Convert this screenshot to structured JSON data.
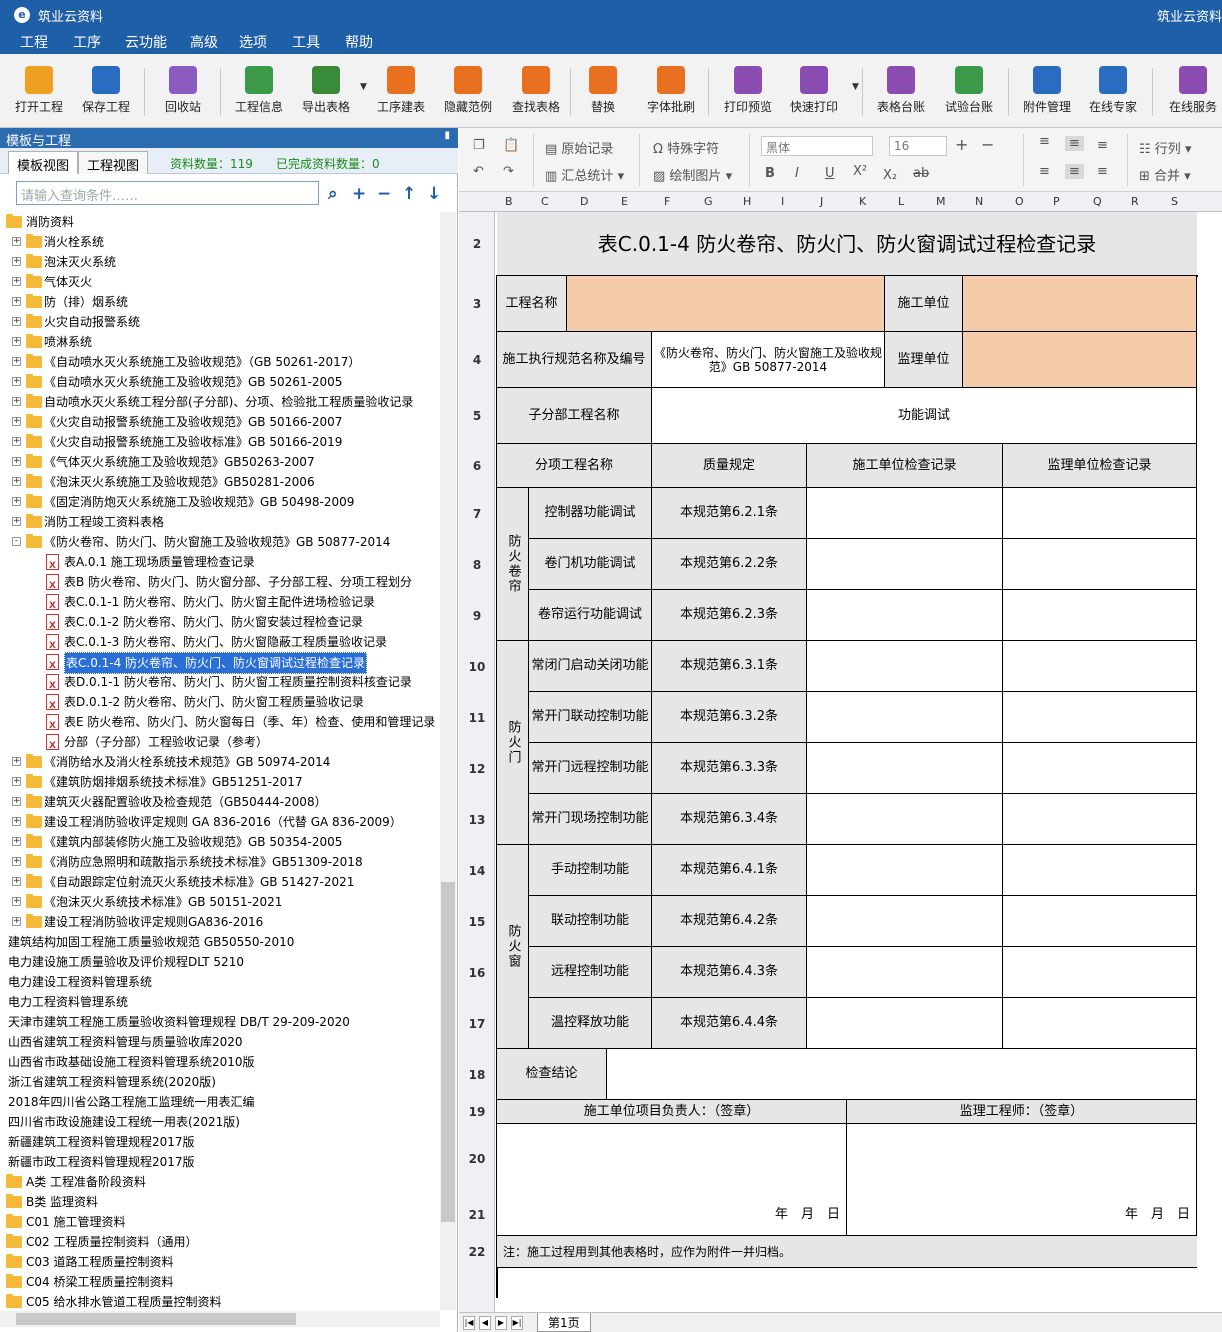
{
  "window": {
    "title": "筑业云资料",
    "title_right": "筑业云资料"
  },
  "menu": [
    "工程",
    "工序",
    "云功能",
    "高级",
    "选项",
    "工具",
    "帮助"
  ],
  "ribbon": [
    {
      "label": "打开工程",
      "icon": "open-folder-icon",
      "color": "#f0a020"
    },
    {
      "label": "保存工程",
      "icon": "save-icon",
      "color": "#2a6cc0"
    },
    {
      "label": "回收站",
      "icon": "trash-icon",
      "color": "#8a5cc0"
    },
    {
      "label": "工程信息",
      "icon": "info-icon",
      "color": "#3a9a4a"
    },
    {
      "label": "导出表格",
      "icon": "export-table-icon",
      "color": "#3a8a3a"
    },
    {
      "label": "工序建表",
      "icon": "layers-icon",
      "color": "#e87020"
    },
    {
      "label": "隐藏范例",
      "icon": "sample-icon",
      "color": "#e87020"
    },
    {
      "label": "查找表格",
      "icon": "find-icon",
      "color": "#e87020"
    },
    {
      "label": "替换",
      "icon": "replace-icon",
      "color": "#e87020"
    },
    {
      "label": "字体批刷",
      "icon": "font-brush-icon",
      "color": "#e87020"
    },
    {
      "label": "打印预览",
      "icon": "print-preview-icon",
      "color": "#8a4cb0"
    },
    {
      "label": "快速打印",
      "icon": "print-icon",
      "color": "#8a4cb0"
    },
    {
      "label": "表格台账",
      "icon": "ledger-icon",
      "color": "#8a4cb0"
    },
    {
      "label": "试验台账",
      "icon": "test-ledger-icon",
      "color": "#3a9a4a"
    },
    {
      "label": "附件管理",
      "icon": "attachment-icon",
      "color": "#2a6cc0"
    },
    {
      "label": "在线专家",
      "icon": "expert-icon",
      "color": "#2a6cc0"
    },
    {
      "label": "在线服务",
      "icon": "service-icon",
      "color": "#8a4cb0"
    }
  ],
  "left": {
    "header": "模板与工程",
    "tabs": [
      "模板视图",
      "工程视图"
    ],
    "count_label": "资料数量：119",
    "done_label": "已完成资料数量：0",
    "search_placeholder": "请输入查询条件……",
    "tree": [
      {
        "t": "消防资料",
        "lv": 0,
        "k": "fo",
        "exp": "-"
      },
      {
        "t": "消火栓系统",
        "lv": 1,
        "k": "f",
        "exp": "+"
      },
      {
        "t": "泡沫灭火系统",
        "lv": 1,
        "k": "f",
        "exp": "+"
      },
      {
        "t": "气体灭火",
        "lv": 1,
        "k": "f",
        "exp": "+"
      },
      {
        "t": "防（排）烟系统",
        "lv": 1,
        "k": "f",
        "exp": "+"
      },
      {
        "t": "火灾自动报警系统",
        "lv": 1,
        "k": "f",
        "exp": "+"
      },
      {
        "t": "喷淋系统",
        "lv": 1,
        "k": "f",
        "exp": "+"
      },
      {
        "t": "《自动喷水灭火系统施工及验收规范》（GB 50261-2017）",
        "lv": 1,
        "k": "f",
        "exp": "+"
      },
      {
        "t": "《自动喷水灭火系统施工及验收规范》GB 50261-2005",
        "lv": 1,
        "k": "f",
        "exp": "+"
      },
      {
        "t": "自动喷水灭火系统工程分部(子分部)、分项、检验批工程质量验收记录",
        "lv": 1,
        "k": "f",
        "exp": "+"
      },
      {
        "t": "《火灾自动报警系统施工及验收规范》GB 50166-2007",
        "lv": 1,
        "k": "f",
        "exp": "+"
      },
      {
        "t": "《火灾自动报警系统施工及验收标准》GB 50166-2019",
        "lv": 1,
        "k": "f",
        "exp": "+"
      },
      {
        "t": "《气体灭火系统施工及验收规范》GB50263-2007",
        "lv": 1,
        "k": "f",
        "exp": "+"
      },
      {
        "t": "《泡沫灭火系统施工及验收规范》GB50281-2006",
        "lv": 1,
        "k": "f",
        "exp": "+"
      },
      {
        "t": "《固定消防炮灭火系统施工及验收规范》GB 50498-2009",
        "lv": 1,
        "k": "f",
        "exp": "+"
      },
      {
        "t": "消防工程竣工资料表格",
        "lv": 1,
        "k": "f",
        "exp": "+"
      },
      {
        "t": "《防火卷帘、防火门、防火窗施工及验收规范》GB 50877-2014",
        "lv": 1,
        "k": "fo",
        "exp": "-"
      },
      {
        "t": "表A.0.1 施工现场质量管理检查记录",
        "lv": 2,
        "k": "d"
      },
      {
        "t": "表B 防火卷帘、防火门、防火窗分部、子分部工程、分项工程划分",
        "lv": 2,
        "k": "d"
      },
      {
        "t": "表C.0.1-1 防火卷帘、防火门、防火窗主配件进场检验记录",
        "lv": 2,
        "k": "d"
      },
      {
        "t": "表C.0.1-2 防火卷帘、防火门、防火窗安装过程检查记录",
        "lv": 2,
        "k": "d"
      },
      {
        "t": "表C.0.1-3 防火卷帘、防火门、防火窗隐蔽工程质量验收记录",
        "lv": 2,
        "k": "d"
      },
      {
        "t": "表C.0.1-4 防火卷帘、防火门、防火窗调试过程检查记录",
        "lv": 2,
        "k": "d",
        "sel": true
      },
      {
        "t": "表D.0.1-1 防火卷帘、防火门、防火窗工程质量控制资料核查记录",
        "lv": 2,
        "k": "d"
      },
      {
        "t": "表D.0.1-2 防火卷帘、防火门、防火窗工程质量验收记录",
        "lv": 2,
        "k": "d"
      },
      {
        "t": "表E 防火卷帘、防火门、防火窗每日（季、年）检查、使用和管理记录",
        "lv": 2,
        "k": "d"
      },
      {
        "t": "分部（子分部）工程验收记录（参考）",
        "lv": 2,
        "k": "d"
      },
      {
        "t": "《消防给水及消火栓系统技术规范》GB 50974-2014",
        "lv": 1,
        "k": "f",
        "exp": "+"
      },
      {
        "t": "《建筑防烟排烟系统技术标准》GB51251-2017",
        "lv": 1,
        "k": "f",
        "exp": "+"
      },
      {
        "t": "建筑灭火器配置验收及检查规范（GB50444-2008）",
        "lv": 1,
        "k": "f",
        "exp": "+"
      },
      {
        "t": "建设工程消防验收评定规则 GA 836-2016（代替 GA 836-2009）",
        "lv": 1,
        "k": "f",
        "exp": "+"
      },
      {
        "t": "《建筑内部装修防火施工及验收规范》GB 50354-2005",
        "lv": 1,
        "k": "f",
        "exp": "+"
      },
      {
        "t": "《消防应急照明和疏散指示系统技术标准》GB51309-2018",
        "lv": 1,
        "k": "f",
        "exp": "+"
      },
      {
        "t": "《自动跟踪定位射流灭火系统技术标准》GB 51427-2021",
        "lv": 1,
        "k": "f",
        "exp": "+"
      },
      {
        "t": "《泡沫灭火系统技术标准》GB 50151-2021",
        "lv": 1,
        "k": "f",
        "exp": "+"
      },
      {
        "t": "建设工程消防验收评定规则GA836-2016",
        "lv": 1,
        "k": "f",
        "exp": "+"
      },
      {
        "t": "建筑结构加固工程施工质量验收规范 GB50550-2010",
        "lv": -1,
        "k": "n"
      },
      {
        "t": "电力建设施工质量验收及评价规程DLT 5210",
        "lv": -1,
        "k": "n"
      },
      {
        "t": "电力建设工程资料管理系统",
        "lv": -1,
        "k": "n"
      },
      {
        "t": "电力工程资料管理系统",
        "lv": -1,
        "k": "n"
      },
      {
        "t": "天津市建筑工程施工质量验收资料管理规程 DB/T 29-209-2020",
        "lv": -1,
        "k": "n"
      },
      {
        "t": "山西省建筑工程资料管理与质量验收库2020",
        "lv": -1,
        "k": "n"
      },
      {
        "t": "山西省市政基础设施工程资料管理系统2010版",
        "lv": -1,
        "k": "n"
      },
      {
        "t": "浙江省建筑工程资料管理系统(2020版)",
        "lv": -1,
        "k": "n"
      },
      {
        "t": "2018年四川省公路工程施工监理统一用表汇编",
        "lv": -1,
        "k": "n"
      },
      {
        "t": "四川省市政设施建设工程统一用表(2021版)",
        "lv": -1,
        "k": "n"
      },
      {
        "t": "新疆建筑工程资料管理规程2017版",
        "lv": -1,
        "k": "n"
      },
      {
        "t": "新疆市政工程资料管理规程2017版",
        "lv": -1,
        "k": "n"
      },
      {
        "t": "A类 工程准备阶段资料",
        "lv": 0,
        "k": "f"
      },
      {
        "t": "B类 监理资料",
        "lv": 0,
        "k": "f"
      },
      {
        "t": "C01 施工管理资料",
        "lv": 0,
        "k": "f"
      },
      {
        "t": "C02 工程质量控制资料（通用）",
        "lv": 0,
        "k": "f"
      },
      {
        "t": "C03 道路工程质量控制资料",
        "lv": 0,
        "k": "f"
      },
      {
        "t": "C04 桥梁工程质量控制资料",
        "lv": 0,
        "k": "f"
      },
      {
        "t": "C05 给水排水管道工程质量控制资料",
        "lv": 0,
        "k": "f"
      }
    ]
  },
  "format": {
    "original_record": "原始记录",
    "special_char": "特殊字符",
    "summary_stats": "汇总统计",
    "draw_picture": "绘制图片",
    "font": "黑体",
    "size": "16",
    "row_height": "行列",
    "merge": "合并",
    "bold": "B",
    "italic": "I",
    "underline": "U",
    "sup": "X²",
    "sub": "X₂",
    "strike": "ab"
  },
  "columns": [
    "B",
    "C",
    "D",
    "E",
    "F",
    "G",
    "H",
    "I",
    "J",
    "K",
    "L",
    "M",
    "N",
    "O",
    "P",
    "Q",
    "R",
    "S"
  ],
  "rows": [
    "2",
    "3",
    "4",
    "5",
    "6",
    "7",
    "8",
    "9",
    "10",
    "11",
    "12",
    "13",
    "14",
    "15",
    "16",
    "17",
    "18",
    "19",
    "20",
    "21",
    "22"
  ],
  "form": {
    "title": "表C.0.1-4 防火卷帘、防火门、防火窗调试过程检查记录",
    "project_name": "工程名称",
    "construction_unit": "施工单位",
    "spec_label": "施工执行规范名称及编号",
    "spec_value": "《防火卷帘、防火门、防火窗施工及验收规范》GB 50877-2014",
    "supervision_unit": "监理单位",
    "subpart_label": "子分部工程名称",
    "subpart_value": "功能调试",
    "h_item": "分项工程名称",
    "h_quality": "质量规定",
    "h_cons_record": "施工单位检查记录",
    "h_sup_record": "监理单位检查记录",
    "groups": [
      {
        "name": "防火卷帘",
        "items": [
          {
            "item": "控制器功能调试",
            "rule": "本规范第6.2.1条"
          },
          {
            "item": "卷门机功能调试",
            "rule": "本规范第6.2.2条"
          },
          {
            "item": "卷帘运行功能调试",
            "rule": "本规范第6.2.3条"
          }
        ]
      },
      {
        "name": "防火门",
        "items": [
          {
            "item": "常闭门启动关闭功能",
            "rule": "本规范第6.3.1条"
          },
          {
            "item": "常开门联动控制功能",
            "rule": "本规范第6.3.2条"
          },
          {
            "item": "常开门远程控制功能",
            "rule": "本规范第6.3.3条"
          },
          {
            "item": "常开门现场控制功能",
            "rule": "本规范第6.3.4条"
          }
        ]
      },
      {
        "name": "防火窗",
        "items": [
          {
            "item": "手动控制功能",
            "rule": "本规范第6.4.1条"
          },
          {
            "item": "联动控制功能",
            "rule": "本规范第6.4.2条"
          },
          {
            "item": "远程控制功能",
            "rule": "本规范第6.4.3条"
          },
          {
            "item": "温控释放功能",
            "rule": "本规范第6.4.4条"
          }
        ]
      }
    ],
    "conclusion": "检查结论",
    "cons_manager": "施工单位项目负责人：（签章）",
    "sup_engineer": "监理工程师：（签章）",
    "date": "年　月　日",
    "note": "注：施工过程用到其他表格时，应作为附件一并归档。"
  },
  "sheet_tab": "第1页"
}
